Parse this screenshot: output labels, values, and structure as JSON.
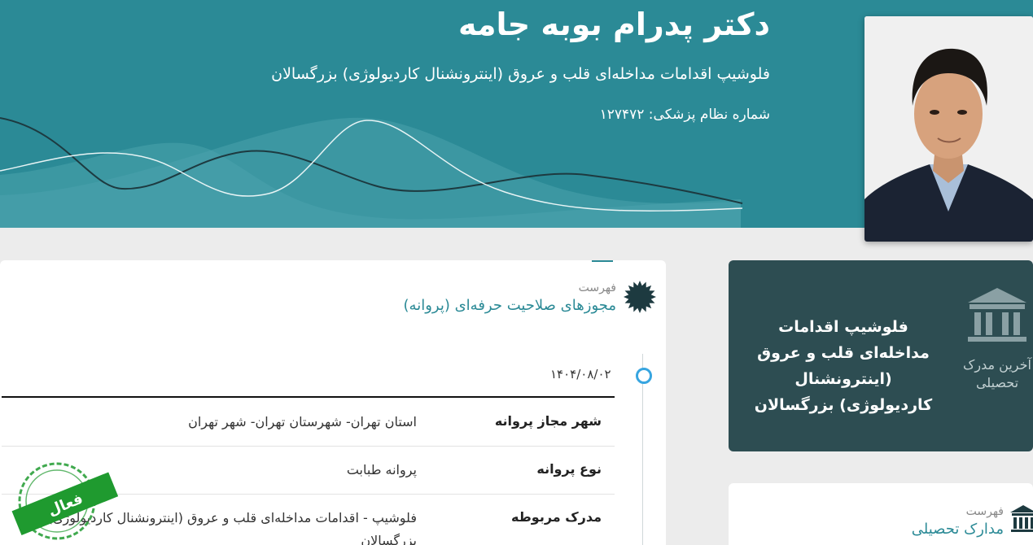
{
  "header": {
    "name": "دکتر پدرام بوبه جامه",
    "specialty": "فلوشیپ اقدامات مداخله‌ای قلب و عروق (اینترونشنال کاردیولوژی) بزرگسالان",
    "registration_label": "شماره نظام پزشکی:",
    "registration_number": "۱۲۷۴۷۲"
  },
  "licenses": {
    "kicker": "فهرست",
    "title": "مجوزهای صلاحیت حرفه‌ای (پروانه)",
    "date": "۱۴۰۴/۰۸/۰۲",
    "rows": [
      {
        "label": "شهر مجاز پروانه",
        "value": "استان تهران- شهرستان تهران- شهر تهران"
      },
      {
        "label": "نوع پروانه",
        "value": "پروانه طبابت"
      },
      {
        "label": "مدرک مربوطه",
        "value": "فلوشیپ - اقدامات مداخله‌ای قلب و عروق (اینترونشنال کاردیولوژی) بزرگسالان"
      }
    ],
    "status_stamp": "فعال"
  },
  "latest_degree": {
    "side_label": "آخرین مدرک تحصیلی",
    "value": "فلوشیپ اقدامات مداخله‌ای قلب و عروق (اینترونشنال کاردیولوژی) بزرگسالان"
  },
  "degrees": {
    "kicker": "فهرست",
    "title": "مدارک تحصیلی"
  },
  "colors": {
    "teal": "#2b8a96",
    "dark_card": "#2d4d52",
    "timeline_dot": "#37a5e0",
    "stamp_green": "#1f9a2f"
  },
  "icons": {
    "section": "seal-badge-icon",
    "degree": "university-building-icon"
  }
}
